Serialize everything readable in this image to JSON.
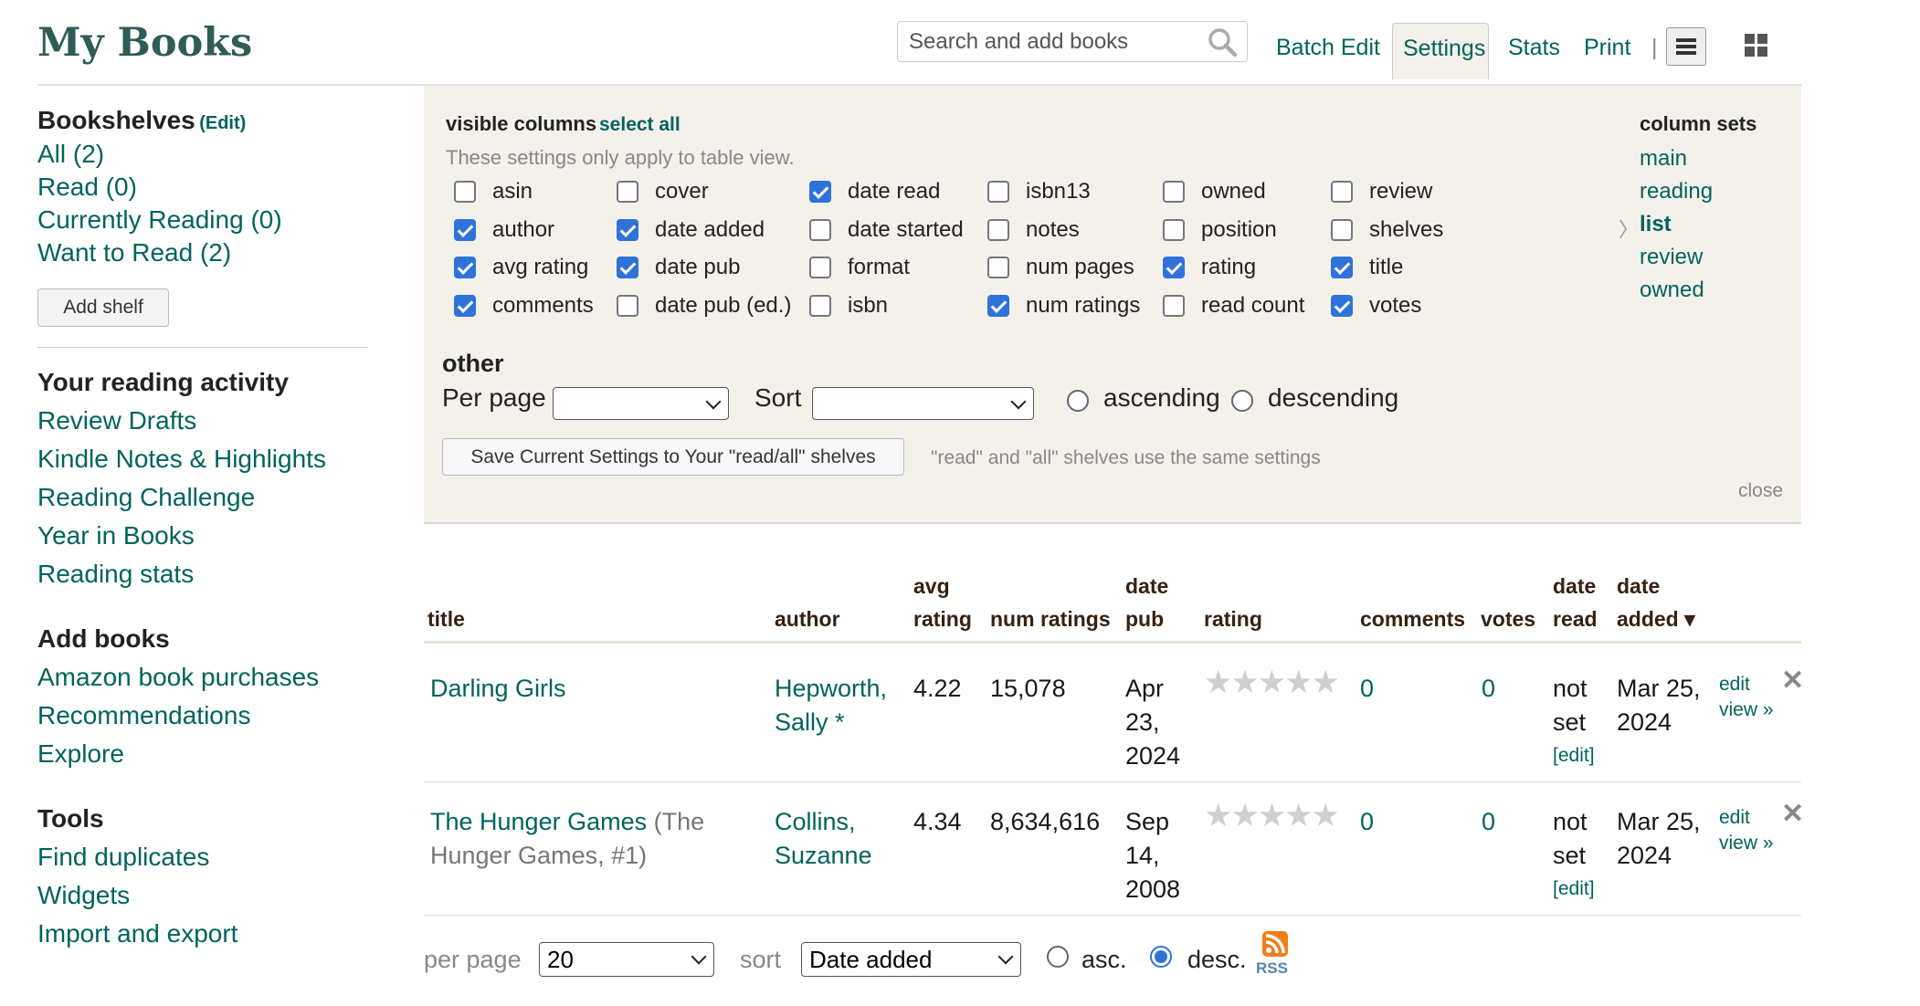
{
  "header": {
    "title": "My Books",
    "search_placeholder": "Search and add books",
    "nav": [
      "Batch Edit",
      "Settings",
      "Stats",
      "Print"
    ],
    "separator": "|",
    "active_tab": "Settings",
    "accent_color": "#00635d"
  },
  "sidebar": {
    "bookshelves_title": "Bookshelves",
    "edit_label": "(Edit)",
    "shelves": [
      "All (2)",
      "Read (0)",
      "Currently Reading (0)",
      "Want to Read (2)"
    ],
    "add_shelf_label": "Add shelf",
    "activity_title": "Your reading activity",
    "activity_links": [
      "Review Drafts",
      "Kindle Notes & Highlights",
      "Reading Challenge",
      "Year in Books",
      "Reading stats"
    ],
    "add_books_title": "Add books",
    "add_books_links": [
      "Amazon book purchases",
      "Recommendations",
      "Explore"
    ],
    "tools_title": "Tools",
    "tools_links": [
      "Find duplicates",
      "Widgets",
      "Import and export"
    ]
  },
  "settings_panel": {
    "visible_columns_label": "visible columns",
    "select_all_label": "select all",
    "note": "These settings only apply to table view.",
    "columns": [
      [
        {
          "label": "asin",
          "checked": false
        },
        {
          "label": "author",
          "checked": true
        },
        {
          "label": "avg rating",
          "checked": true
        },
        {
          "label": "comments",
          "checked": true
        }
      ],
      [
        {
          "label": "cover",
          "checked": false
        },
        {
          "label": "date added",
          "checked": true
        },
        {
          "label": "date pub",
          "checked": true
        },
        {
          "label": "date pub (ed.)",
          "checked": false
        }
      ],
      [
        {
          "label": "date read",
          "checked": true
        },
        {
          "label": "date started",
          "checked": false
        },
        {
          "label": "format",
          "checked": false
        },
        {
          "label": "isbn",
          "checked": false
        }
      ],
      [
        {
          "label": "isbn13",
          "checked": false
        },
        {
          "label": "notes",
          "checked": false
        },
        {
          "label": "num pages",
          "checked": false
        },
        {
          "label": "num ratings",
          "checked": true
        }
      ],
      [
        {
          "label": "owned",
          "checked": false
        },
        {
          "label": "position",
          "checked": false
        },
        {
          "label": "rating",
          "checked": true
        },
        {
          "label": "read count",
          "checked": false
        }
      ],
      [
        {
          "label": "review",
          "checked": false
        },
        {
          "label": "shelves",
          "checked": false
        },
        {
          "label": "title",
          "checked": true
        },
        {
          "label": "votes",
          "checked": true
        }
      ]
    ],
    "column_sets_title": "column sets",
    "column_sets": [
      "main",
      "reading",
      "list",
      "review",
      "owned"
    ],
    "active_column_set": "list",
    "other_title": "other",
    "per_page_label": "Per page",
    "per_page_value": "",
    "sort_label": "Sort",
    "sort_value": "",
    "ascending_label": "ascending",
    "descending_label": "descending",
    "save_label": "Save Current Settings to Your \"read/all\" shelves",
    "same_settings_note": "\"read\" and \"all\" shelves use the same settings",
    "close_label": "close"
  },
  "table": {
    "headers": {
      "title": "title",
      "author": "author",
      "avg_rating": [
        "avg",
        "rating"
      ],
      "num_ratings": "num ratings",
      "date_pub": [
        "date",
        "pub"
      ],
      "rating": "rating",
      "comments": "comments",
      "votes": "votes",
      "date_read": [
        "date",
        "read"
      ],
      "date_added": [
        "date",
        "added ▾"
      ]
    },
    "rows": [
      {
        "title": "Darling Girls",
        "series": "",
        "author": [
          "Hepworth,",
          "Sally *"
        ],
        "avg_rating": "4.22",
        "num_ratings": "15,078",
        "date_pub": [
          "Apr",
          "23,",
          "2024"
        ],
        "rating": 0,
        "comments": "0",
        "votes": "0",
        "date_read": [
          "not",
          "set"
        ],
        "date_read_edit": "[edit]",
        "date_added": [
          "Mar 25,",
          "2024"
        ],
        "edit_label": "edit",
        "view_label": "view »"
      },
      {
        "title": "The Hunger Games",
        "series": "(The",
        "series2": "Hunger Games, #1)",
        "author": [
          "Collins,",
          "Suzanne"
        ],
        "avg_rating": "4.34",
        "num_ratings": "8,634,616",
        "date_pub": [
          "Sep",
          "14,",
          "2008"
        ],
        "rating": 0,
        "comments": "0",
        "votes": "0",
        "date_read": [
          "not",
          "set"
        ],
        "date_read_edit": "[edit]",
        "date_added": [
          "Mar 25,",
          "2024"
        ],
        "edit_label": "edit",
        "view_label": "view »"
      }
    ]
  },
  "footer": {
    "per_page_label": "per page",
    "per_page_value": "20",
    "sort_label": "sort",
    "sort_value": "Date added",
    "asc_label": "asc.",
    "desc_label": "desc.",
    "order": "desc",
    "rss_label": "RSS"
  }
}
